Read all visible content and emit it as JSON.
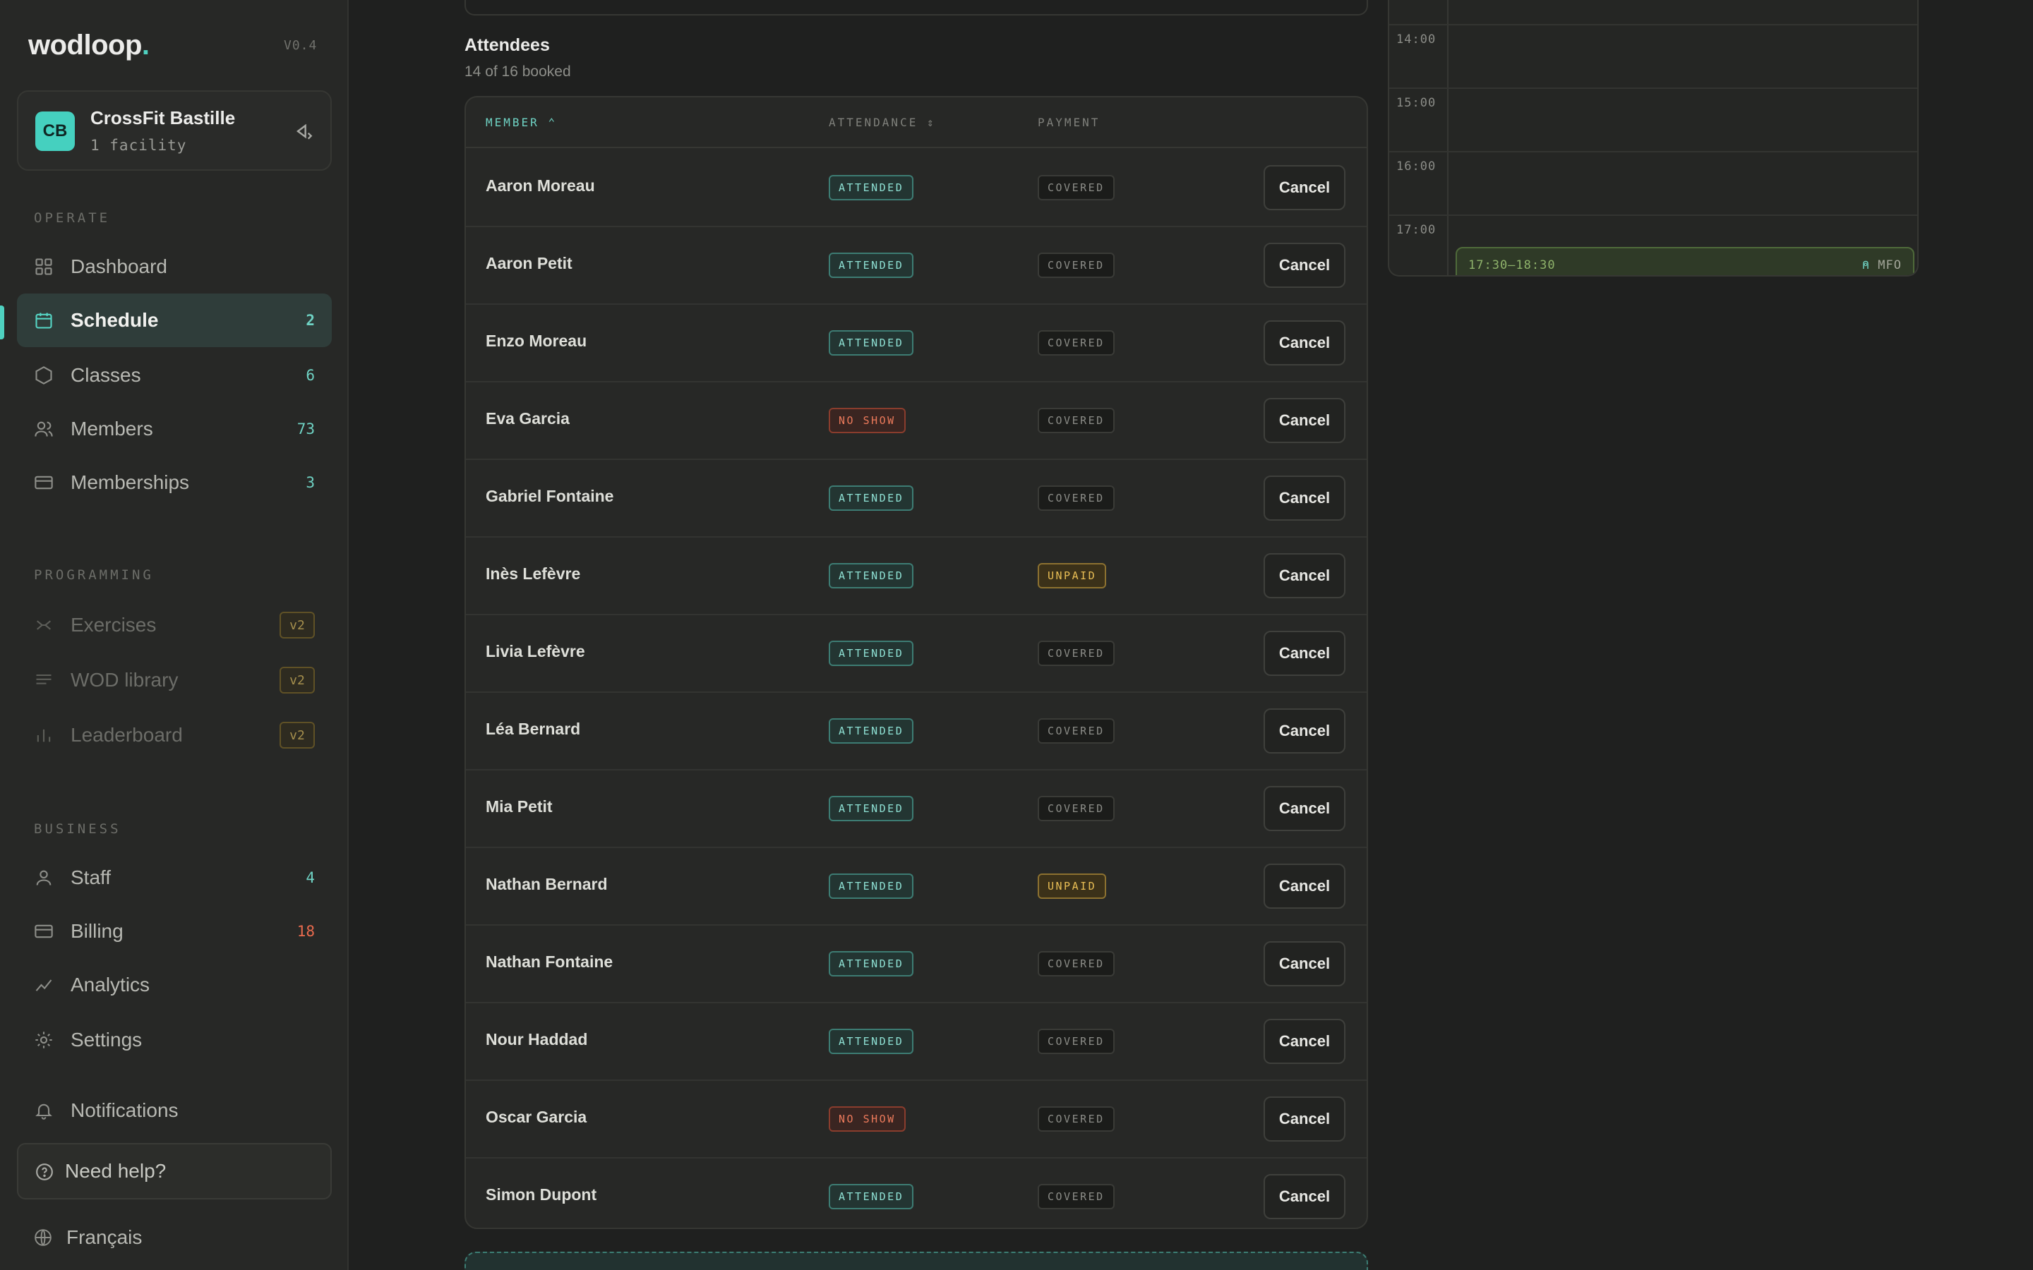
{
  "app": {
    "brand": "wodloop",
    "brand_dot": ".",
    "version": "V0.4"
  },
  "org": {
    "initials": "CB",
    "name": "CrossFit Bastille",
    "sub": "1 facility"
  },
  "sections": {
    "operate": "OPERATE",
    "programming": "PROGRAMMING",
    "business": "BUSINESS"
  },
  "nav": {
    "dashboard": {
      "label": "Dashboard"
    },
    "schedule": {
      "label": "Schedule",
      "count": "2"
    },
    "classes": {
      "label": "Classes",
      "count": "6"
    },
    "members": {
      "label": "Members",
      "count": "73"
    },
    "memberships": {
      "label": "Memberships",
      "count": "3"
    },
    "exercises": {
      "label": "Exercises",
      "badge": "v2"
    },
    "wod_library": {
      "label": "WOD library",
      "badge": "v2"
    },
    "leaderboard": {
      "label": "Leaderboard",
      "badge": "v2"
    },
    "staff": {
      "label": "Staff",
      "count": "4"
    },
    "billing": {
      "label": "Billing",
      "count": "18"
    },
    "analytics": {
      "label": "Analytics"
    },
    "settings": {
      "label": "Settings"
    },
    "notifications": {
      "label": "Notifications"
    }
  },
  "help": {
    "label": "Need help?"
  },
  "language": {
    "label": "Français"
  },
  "attendees": {
    "title": "Attendees",
    "subtitle": "14 of 16 booked",
    "columns": {
      "member": "MEMBER",
      "member_sort": "⌃",
      "attendance": "ATTENDANCE",
      "attendance_sort": "⇕",
      "payment": "PAYMENT"
    },
    "rows": [
      {
        "name": "Aaron Moreau",
        "attendance": "ATTENDED",
        "payment": "COVERED",
        "action": "Cancel"
      },
      {
        "name": "Aaron Petit",
        "attendance": "ATTENDED",
        "payment": "COVERED",
        "action": "Cancel"
      },
      {
        "name": "Enzo Moreau",
        "attendance": "ATTENDED",
        "payment": "COVERED",
        "action": "Cancel"
      },
      {
        "name": "Eva Garcia",
        "attendance": "NO SHOW",
        "payment": "COVERED",
        "action": "Cancel"
      },
      {
        "name": "Gabriel Fontaine",
        "attendance": "ATTENDED",
        "payment": "COVERED",
        "action": "Cancel"
      },
      {
        "name": "Inès Lefèvre",
        "attendance": "ATTENDED",
        "payment": "UNPAID",
        "action": "Cancel"
      },
      {
        "name": "Livia Lefèvre",
        "attendance": "ATTENDED",
        "payment": "COVERED",
        "action": "Cancel"
      },
      {
        "name": "Léa Bernard",
        "attendance": "ATTENDED",
        "payment": "COVERED",
        "action": "Cancel"
      },
      {
        "name": "Mia Petit",
        "attendance": "ATTENDED",
        "payment": "COVERED",
        "action": "Cancel"
      },
      {
        "name": "Nathan Bernard",
        "attendance": "ATTENDED",
        "payment": "UNPAID",
        "action": "Cancel"
      },
      {
        "name": "Nathan Fontaine",
        "attendance": "ATTENDED",
        "payment": "COVERED",
        "action": "Cancel"
      },
      {
        "name": "Nour Haddad",
        "attendance": "ATTENDED",
        "payment": "COVERED",
        "action": "Cancel"
      },
      {
        "name": "Oscar Garcia",
        "attendance": "NO SHOW",
        "payment": "COVERED",
        "action": "Cancel"
      },
      {
        "name": "Simon Dupont",
        "attendance": "ATTENDED",
        "payment": "COVERED",
        "action": "Cancel"
      }
    ]
  },
  "calendar": {
    "hours": [
      "14:00",
      "15:00",
      "16:00",
      "17:00"
    ],
    "event": {
      "time": "17:30–18:30",
      "coach": "MFO",
      "coach_icon": "person-icon"
    }
  },
  "colors": {
    "accent": "#4fd1c0",
    "attended": "#8ee0d3",
    "no_show": "#ec7a5b",
    "unpaid": "#e9be55",
    "billing_count": "#ea6b4e"
  }
}
